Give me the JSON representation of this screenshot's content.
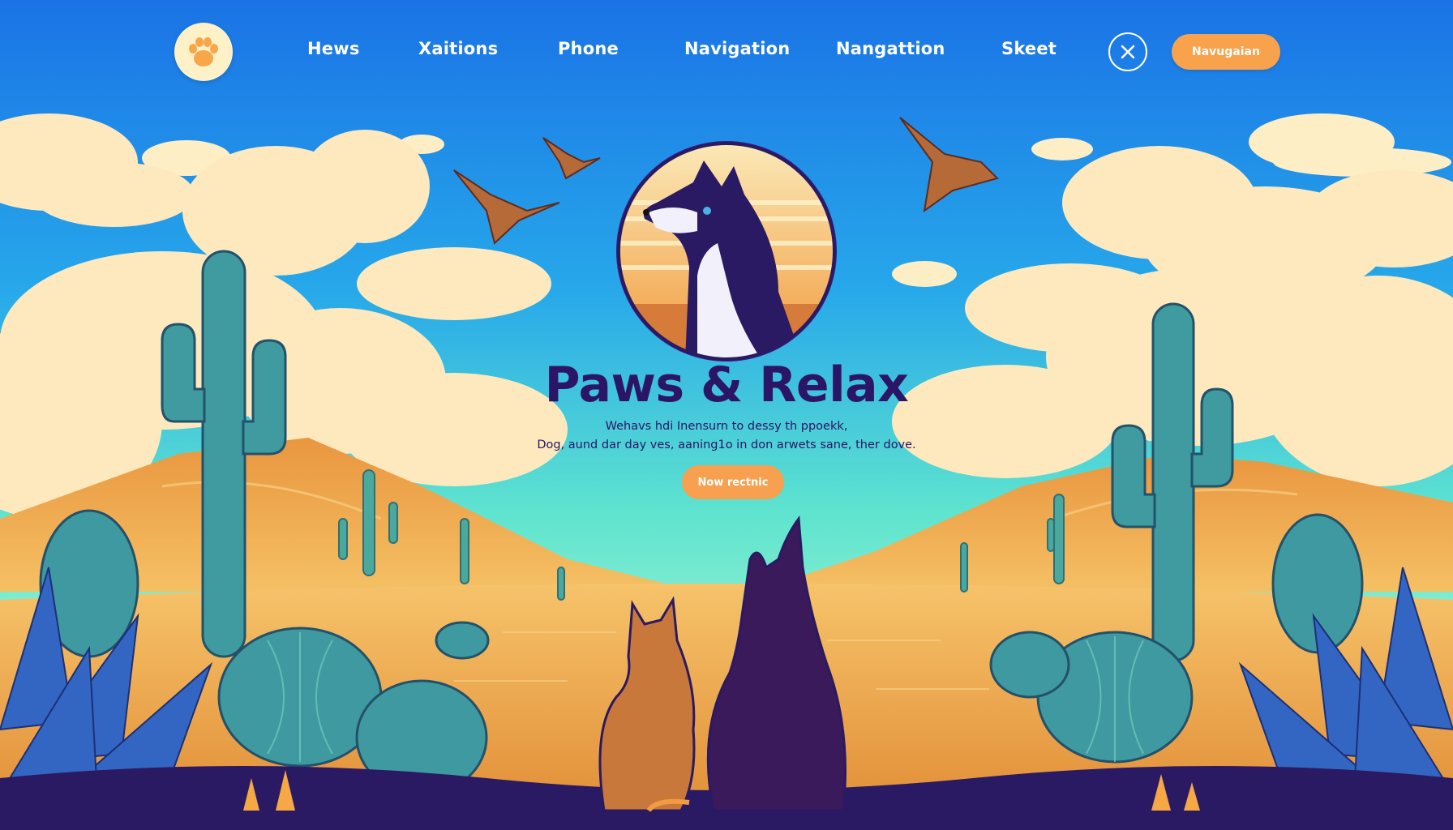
{
  "nav": {
    "links": [
      "Hews",
      "Xaitions",
      "Phone",
      "Navigation",
      "Nangattion",
      "Skeet"
    ],
    "cta_label": "Navugaian"
  },
  "hero": {
    "title": "Paws & Relax",
    "subtitle_line1": "Wehavs hdi Inensurn to dessy th ppoekk,",
    "subtitle_line2": "Dog, aund dar day ves, aaning1o in don arwets sane, ther dove.",
    "cta_label": "Now rectnic"
  },
  "icons": {
    "logo": "paw-icon",
    "close": "close-icon"
  },
  "colors": {
    "sky_top": "#1e7fe8",
    "sky_bottom": "#63eac8",
    "accent_orange": "#f9a24c",
    "title_purple": "#2b1566",
    "sand": "#f2b456",
    "cactus": "#3f9b9f"
  }
}
